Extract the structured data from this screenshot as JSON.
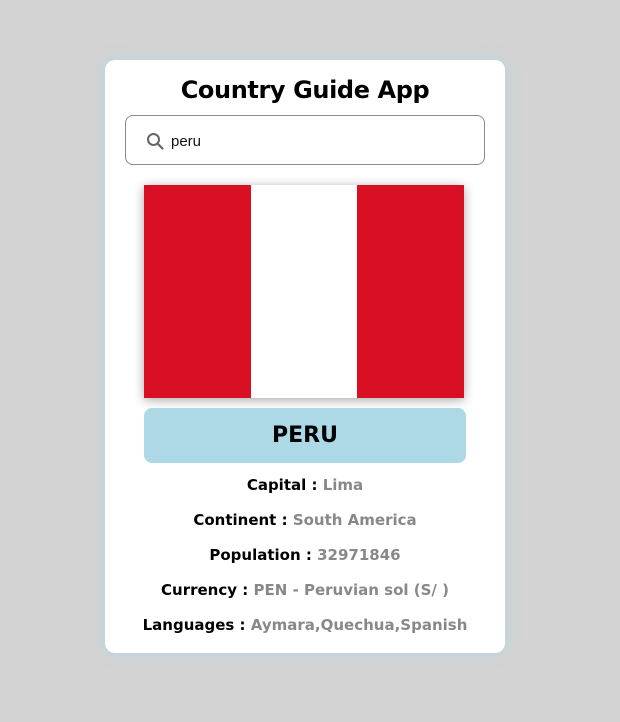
{
  "app": {
    "title": "Country Guide App"
  },
  "search": {
    "icon": "search-icon",
    "value": "peru",
    "placeholder": ""
  },
  "country": {
    "name": "PERU",
    "flag": {
      "description_colors": [
        "#d90f23",
        "#ffffff",
        "#d90f23"
      ]
    },
    "details": [
      {
        "label": "Capital :",
        "value": "Lima"
      },
      {
        "label": "Continent :",
        "value": "South America"
      },
      {
        "label": "Population :",
        "value": "32971846"
      },
      {
        "label": "Currency :",
        "value": "PEN - Peruvian sol (S/ )"
      },
      {
        "label": "Languages :",
        "value": "Aymara,Quechua,Spanish"
      }
    ]
  },
  "colors": {
    "page_background": "#d3d3d3",
    "card_background": "#ffffff",
    "name_badge": "#add8e6",
    "value_text": "#888888"
  }
}
